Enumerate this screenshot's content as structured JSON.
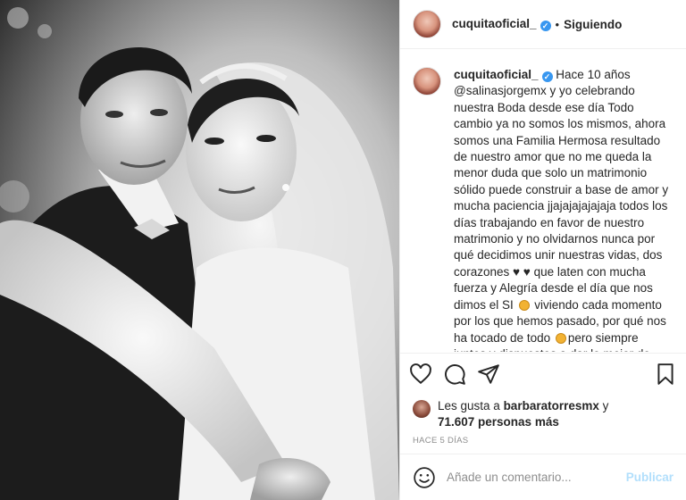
{
  "post": {
    "username": "cuquitaoficial_",
    "separator": "•",
    "follow_status": "Siguiendo",
    "caption_parts": [
      "Hace 10 años ",
      "@salinasjorgemx",
      " y yo celebrando nuestra Boda desde ese día Todo cambio ya no somos los mismos, ahora somos una Familia Hermosa resultado de nuestro amor que no me queda la menor duda que solo un matrimonio sólido puede construir a base de amor y mucha paciencia jjajajajajajaja todos los días trabajando en favor de nuestro matrimonio y no olvidarnos nunca por qué decidimos unir nuestras vidas, dos corazones ♥ ♥ que laten con mucha fuerza y Alegría desde el día que nos dimos el SI ",
      " viviendo cada momento por los que hemos pasado, por qué nos ha tocado de todo ",
      "pero siempre juntos y dispuestos a dar lo mejor de nosotros TE AMO "
    ],
    "likes": {
      "prefix": "Les gusta a ",
      "first_user": "barbaratorresmx",
      "connector": " y",
      "count": "71.607 personas más"
    },
    "time_ago": "HACE 5 DÍAS"
  },
  "icons": {
    "like": "heart-icon",
    "comment": "comment-icon",
    "share": "share-icon",
    "save": "bookmark-icon",
    "emoji": "emoji-icon",
    "verified": "verified-badge-icon"
  },
  "comment_input": {
    "placeholder": "Añade un comentario...",
    "submit_label": "Publicar"
  },
  "colors": {
    "verified": "#3897f0",
    "publish_disabled": "#b2dffc",
    "muted": "#8e8e8e",
    "text": "#262626"
  }
}
